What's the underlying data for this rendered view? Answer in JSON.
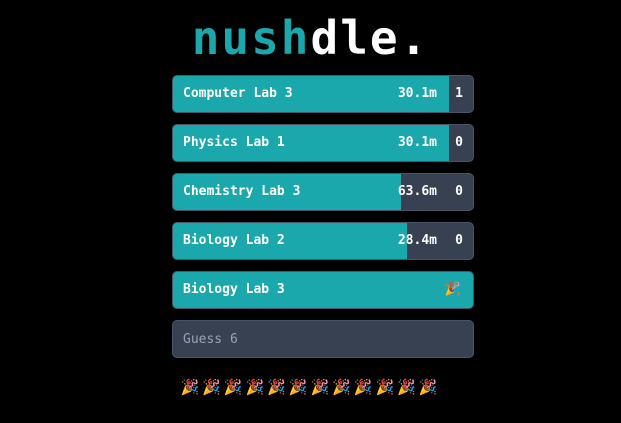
{
  "title": {
    "accent": "nush",
    "rest": "dle."
  },
  "colors": {
    "accent": "#1aa8ad",
    "panel": "#384152",
    "background": "#000000"
  },
  "guesses": [
    {
      "name": "Computer Lab 3",
      "distance": "30.1m",
      "count": "1",
      "fill_fraction": 0.92
    },
    {
      "name": "Physics Lab 1",
      "distance": "30.1m",
      "count": "0",
      "fill_fraction": 0.92
    },
    {
      "name": "Chemistry Lab 3",
      "distance": "63.6m",
      "count": "0",
      "fill_fraction": 0.76
    },
    {
      "name": "Biology Lab 2",
      "distance": "28.4m",
      "count": "0",
      "fill_fraction": 0.78
    }
  ],
  "answer": {
    "name": "Biology Lab 3",
    "emoji": "🎉"
  },
  "input": {
    "placeholder": "Guess 6",
    "value": ""
  },
  "share": {
    "emojis": "🎉🎉🎉🎉🎉🎉🎉🎉🎉🎉🎉🎉"
  }
}
